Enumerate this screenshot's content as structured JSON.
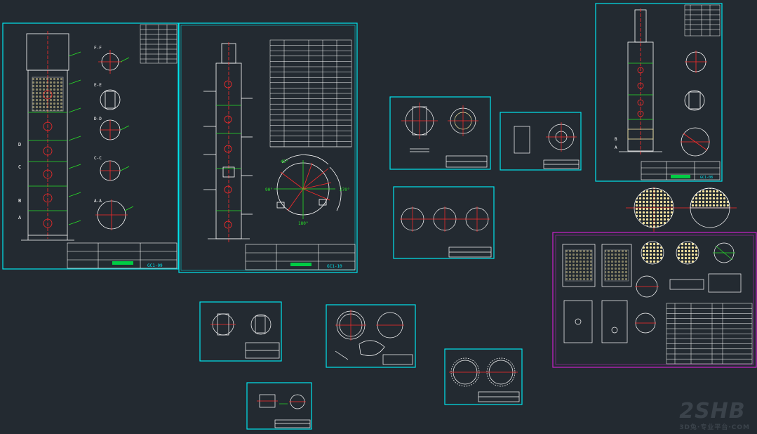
{
  "watermark": {
    "brand": "2SHB",
    "site": "3D兔·专业平台·COM"
  },
  "sheets": [
    {
      "id": "s1",
      "labels": {
        "sheet_no": "GC1-09",
        "sections": [
          "F-F",
          "E-E",
          "D-D",
          "C-C",
          "A-A"
        ],
        "side_marks": [
          "D",
          "C",
          "B",
          "A"
        ]
      }
    },
    {
      "id": "s2",
      "labels": {
        "sheet_no": "GC1-10",
        "angles": [
          "45°",
          "270°",
          "180°",
          "90°"
        ]
      }
    },
    {
      "id": "s3",
      "labels": {
        "sheet_no": "GC1-08",
        "side_marks": [
          "B",
          "A"
        ]
      }
    }
  ],
  "colors": {
    "background": "#232a31",
    "frame": "#00e5ee",
    "line": "#ffffff",
    "centerline": "#ff2a2a",
    "dimension": "#28e028",
    "hatch": "#f4e4a0",
    "highlight": "#cc22cc",
    "accent_block": "#00cc44"
  }
}
